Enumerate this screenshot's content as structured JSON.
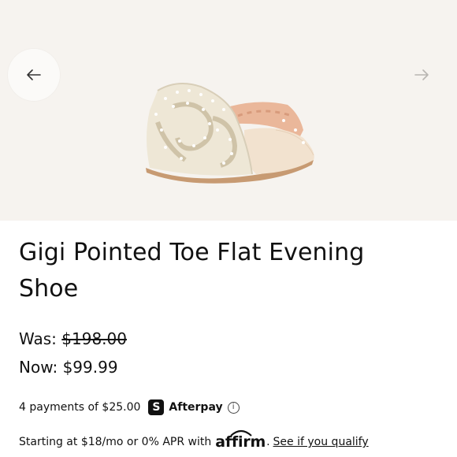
{
  "gallery": {
    "prev_icon": "arrow-left-icon",
    "next_icon": "arrow-right-icon",
    "product_image": "jeweled-evening-flat-shoe"
  },
  "product": {
    "title": "Gigi Pointed Toe Flat Evening Shoe"
  },
  "pricing": {
    "was_label": "Was:",
    "was_price": "$198.00",
    "now_label": "Now:",
    "now_price": "$99.99"
  },
  "afterpay": {
    "text": "4 payments of $25.00",
    "logo_glyph": "S",
    "brand": "Afterpay",
    "info_glyph": "i"
  },
  "affirm": {
    "prefix": "Starting at $18/mo or 0% APR with",
    "brand": "affirm",
    "suffix": ".",
    "link": "See if you qualify"
  }
}
